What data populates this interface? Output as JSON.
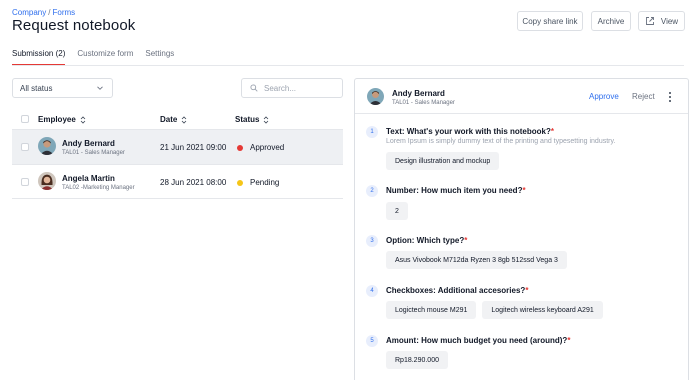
{
  "breadcrumb": {
    "root": "Company",
    "separator": "/",
    "current": "Forms"
  },
  "page_title": "Request notebook",
  "header_actions": {
    "copy_link": "Copy share link",
    "archive": "Archive",
    "view": "View",
    "view_icon": "external-link-icon"
  },
  "tabs": [
    {
      "label": "Submission (2)",
      "active": true
    },
    {
      "label": "Customize form",
      "active": false
    },
    {
      "label": "Settings",
      "active": false
    }
  ],
  "filter": {
    "selected": "All status",
    "icon": "chevron-down-icon"
  },
  "search": {
    "placeholder": "Search...",
    "value": "",
    "icon": "search-icon"
  },
  "table": {
    "columns": {
      "employee": "Employee",
      "date": "Date",
      "status": "Status"
    },
    "rows": [
      {
        "name": "Andy Bernard",
        "subtitle": "TAL01 - Sales Manager",
        "date": "21 Jun 2021 09:00",
        "status": "Approved",
        "status_color": "#e53935",
        "selected": true
      },
      {
        "name": "Angela Martin",
        "subtitle": "TAL02 -Marketing Manager",
        "date": "28 Jun 2021 08:00",
        "status": "Pending",
        "status_color": "#f5c518",
        "selected": false
      }
    ]
  },
  "detail": {
    "name": "Andy Bernard",
    "subtitle": "TAL01 - Sales Manager",
    "approve_label": "Approve",
    "reject_label": "Reject",
    "more_icon": "more-vertical-icon",
    "questions": [
      {
        "number": "1",
        "title": "Text: What's your work with this notebook?",
        "required_mark": "*",
        "description": "Lorem Ipsum is simply dummy text of the printing and typesetting industry.",
        "answers": [
          "Design illustration and mockup"
        ]
      },
      {
        "number": "2",
        "title": "Number: How much item you need?",
        "required_mark": "*",
        "description": "",
        "answers": [
          "2"
        ]
      },
      {
        "number": "3",
        "title": "Option: Which type?",
        "required_mark": "*",
        "description": "",
        "answers": [
          "Asus Vivobook M712da Ryzen 3 8gb 512ssd Vega 3"
        ]
      },
      {
        "number": "4",
        "title": "Checkboxes: Additional accesories?",
        "required_mark": "*",
        "description": "",
        "answers": [
          "Logictech mouse M291",
          "Logitech wireless keyboard A291"
        ]
      },
      {
        "number": "5",
        "title": "Amount: How much budget you need (around)?",
        "required_mark": "*",
        "description": "",
        "answers": [
          "Rp18.290.000"
        ]
      }
    ]
  },
  "colors": {
    "accent": "#2f6fed",
    "tab_underline": "#e53935",
    "selected_row": "#eef0f3"
  }
}
